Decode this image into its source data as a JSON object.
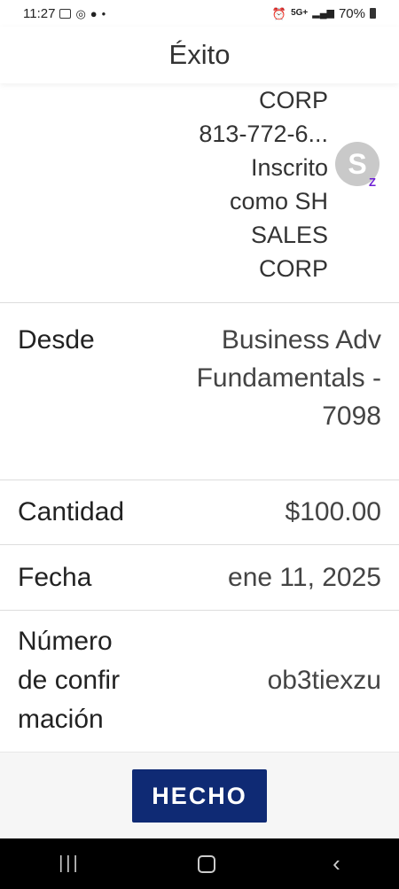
{
  "status_bar": {
    "time": "11:27",
    "signal_label": "5G+",
    "battery": "70%"
  },
  "header": {
    "title": "Éxito"
  },
  "recipient": {
    "lines": [
      "CORP",
      "813-772-6...",
      "Inscrito",
      "como SH",
      "SALES",
      "CORP"
    ],
    "avatar_initial": "S",
    "badge": "Z"
  },
  "details": {
    "from": {
      "label": "Desde",
      "value_lines": [
        "Business Adv",
        "Fundamentals -",
        "7098"
      ]
    },
    "amount": {
      "label": "Cantidad",
      "value": "$100.00"
    },
    "date": {
      "label": "Fecha",
      "value": "ene 11, 2025"
    },
    "confirmation": {
      "label_lines": [
        "Número",
        "de confir",
        "mación"
      ],
      "value": "ob3tiexzu"
    }
  },
  "footer": {
    "done_label": "HECHO"
  },
  "colors": {
    "primary_button": "#0f2a74",
    "zelle_purple": "#6d1ed4"
  }
}
